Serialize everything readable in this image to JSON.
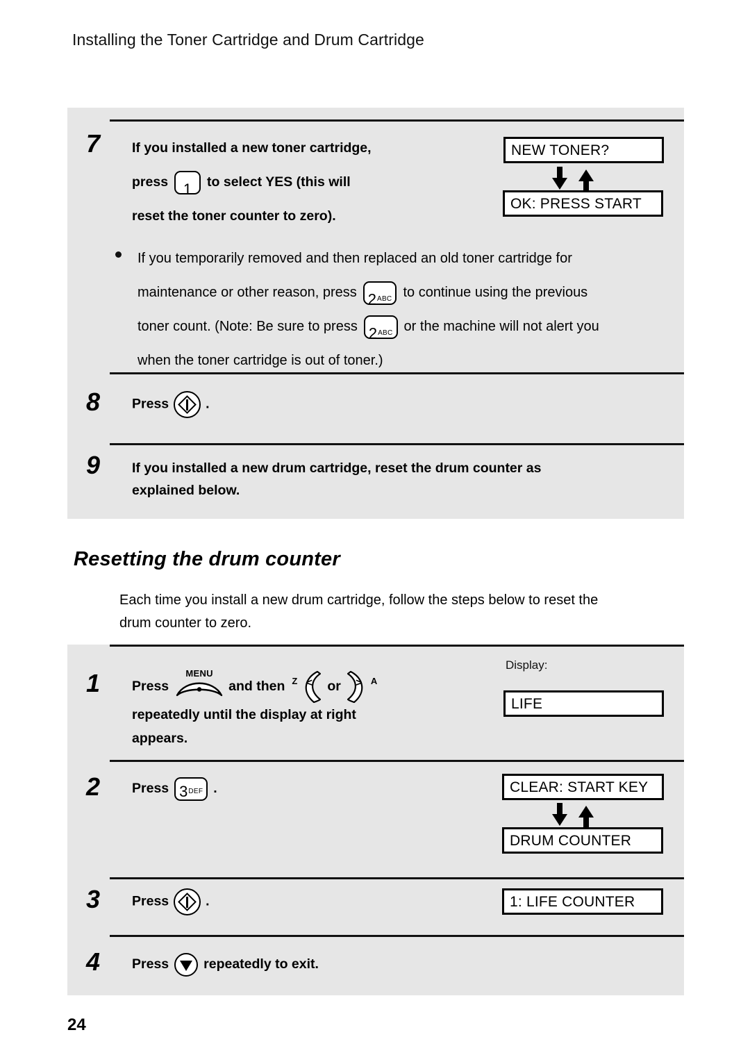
{
  "header": {
    "title": "Installing the Toner Cartridge and Drum Cartridge"
  },
  "page_number": "24",
  "toner_section": {
    "step7": {
      "number": "7",
      "line1": "If you installed a new toner cartridge,",
      "line2_pre": "press",
      "key": {
        "digit": "1",
        "letters": ""
      },
      "line2_post": "to select YES (this will",
      "line3": "reset the toner counter to zero)."
    },
    "bullet": {
      "seg1": "If you temporarily removed and then replaced an old toner cartridge for",
      "seg2": "maintenance or other reason, press",
      "key1": {
        "digit": "2",
        "letters": "ABC"
      },
      "seg3": "to continue using the previous",
      "seg4": "toner count. (Note: Be sure to press",
      "key2": {
        "digit": "2",
        "letters": "ABC"
      },
      "seg5": "or the machine will not alert you",
      "seg6": "when the toner cartridge is out of toner.)"
    },
    "step8": {
      "number": "8",
      "pre": "Press",
      "key_name": "start-key",
      "post": "."
    },
    "step9": {
      "number": "9",
      "line1": "If you installed a new drum cartridge, reset the drum counter as",
      "line2": "explained below."
    },
    "displays": {
      "top": "NEW TONER?",
      "bottom": "OK: PRESS START"
    }
  },
  "drum_section": {
    "heading": "Resetting the drum counter",
    "intro_line1": "Each time you install a new drum cartridge, follow the steps below to reset the",
    "intro_line2": "drum counter to zero.",
    "step1": {
      "number": "1",
      "pre": "Press",
      "menu_label": "MENU",
      "mid": "and then",
      "left_tag": "Z",
      "left_glyph": "<",
      "or": "or",
      "right_glyph": ">",
      "right_tag": "A",
      "line2": "repeatedly until the display at right",
      "line3": "appears."
    },
    "step2": {
      "number": "2",
      "pre": "Press",
      "key": {
        "digit": "3",
        "letters": "DEF"
      },
      "post": "."
    },
    "step3": {
      "number": "3",
      "pre": "Press",
      "key_name": "start-key",
      "post": "."
    },
    "step4": {
      "number": "4",
      "pre": "Press",
      "key_name": "stop-key",
      "post": "repeatedly to exit."
    },
    "displays": {
      "display_label": "Display:",
      "life": "LIFE",
      "clear_start_key": "CLEAR: START KEY",
      "drum_counter": "DRUM COUNTER",
      "life_counter": "1: LIFE COUNTER"
    }
  }
}
